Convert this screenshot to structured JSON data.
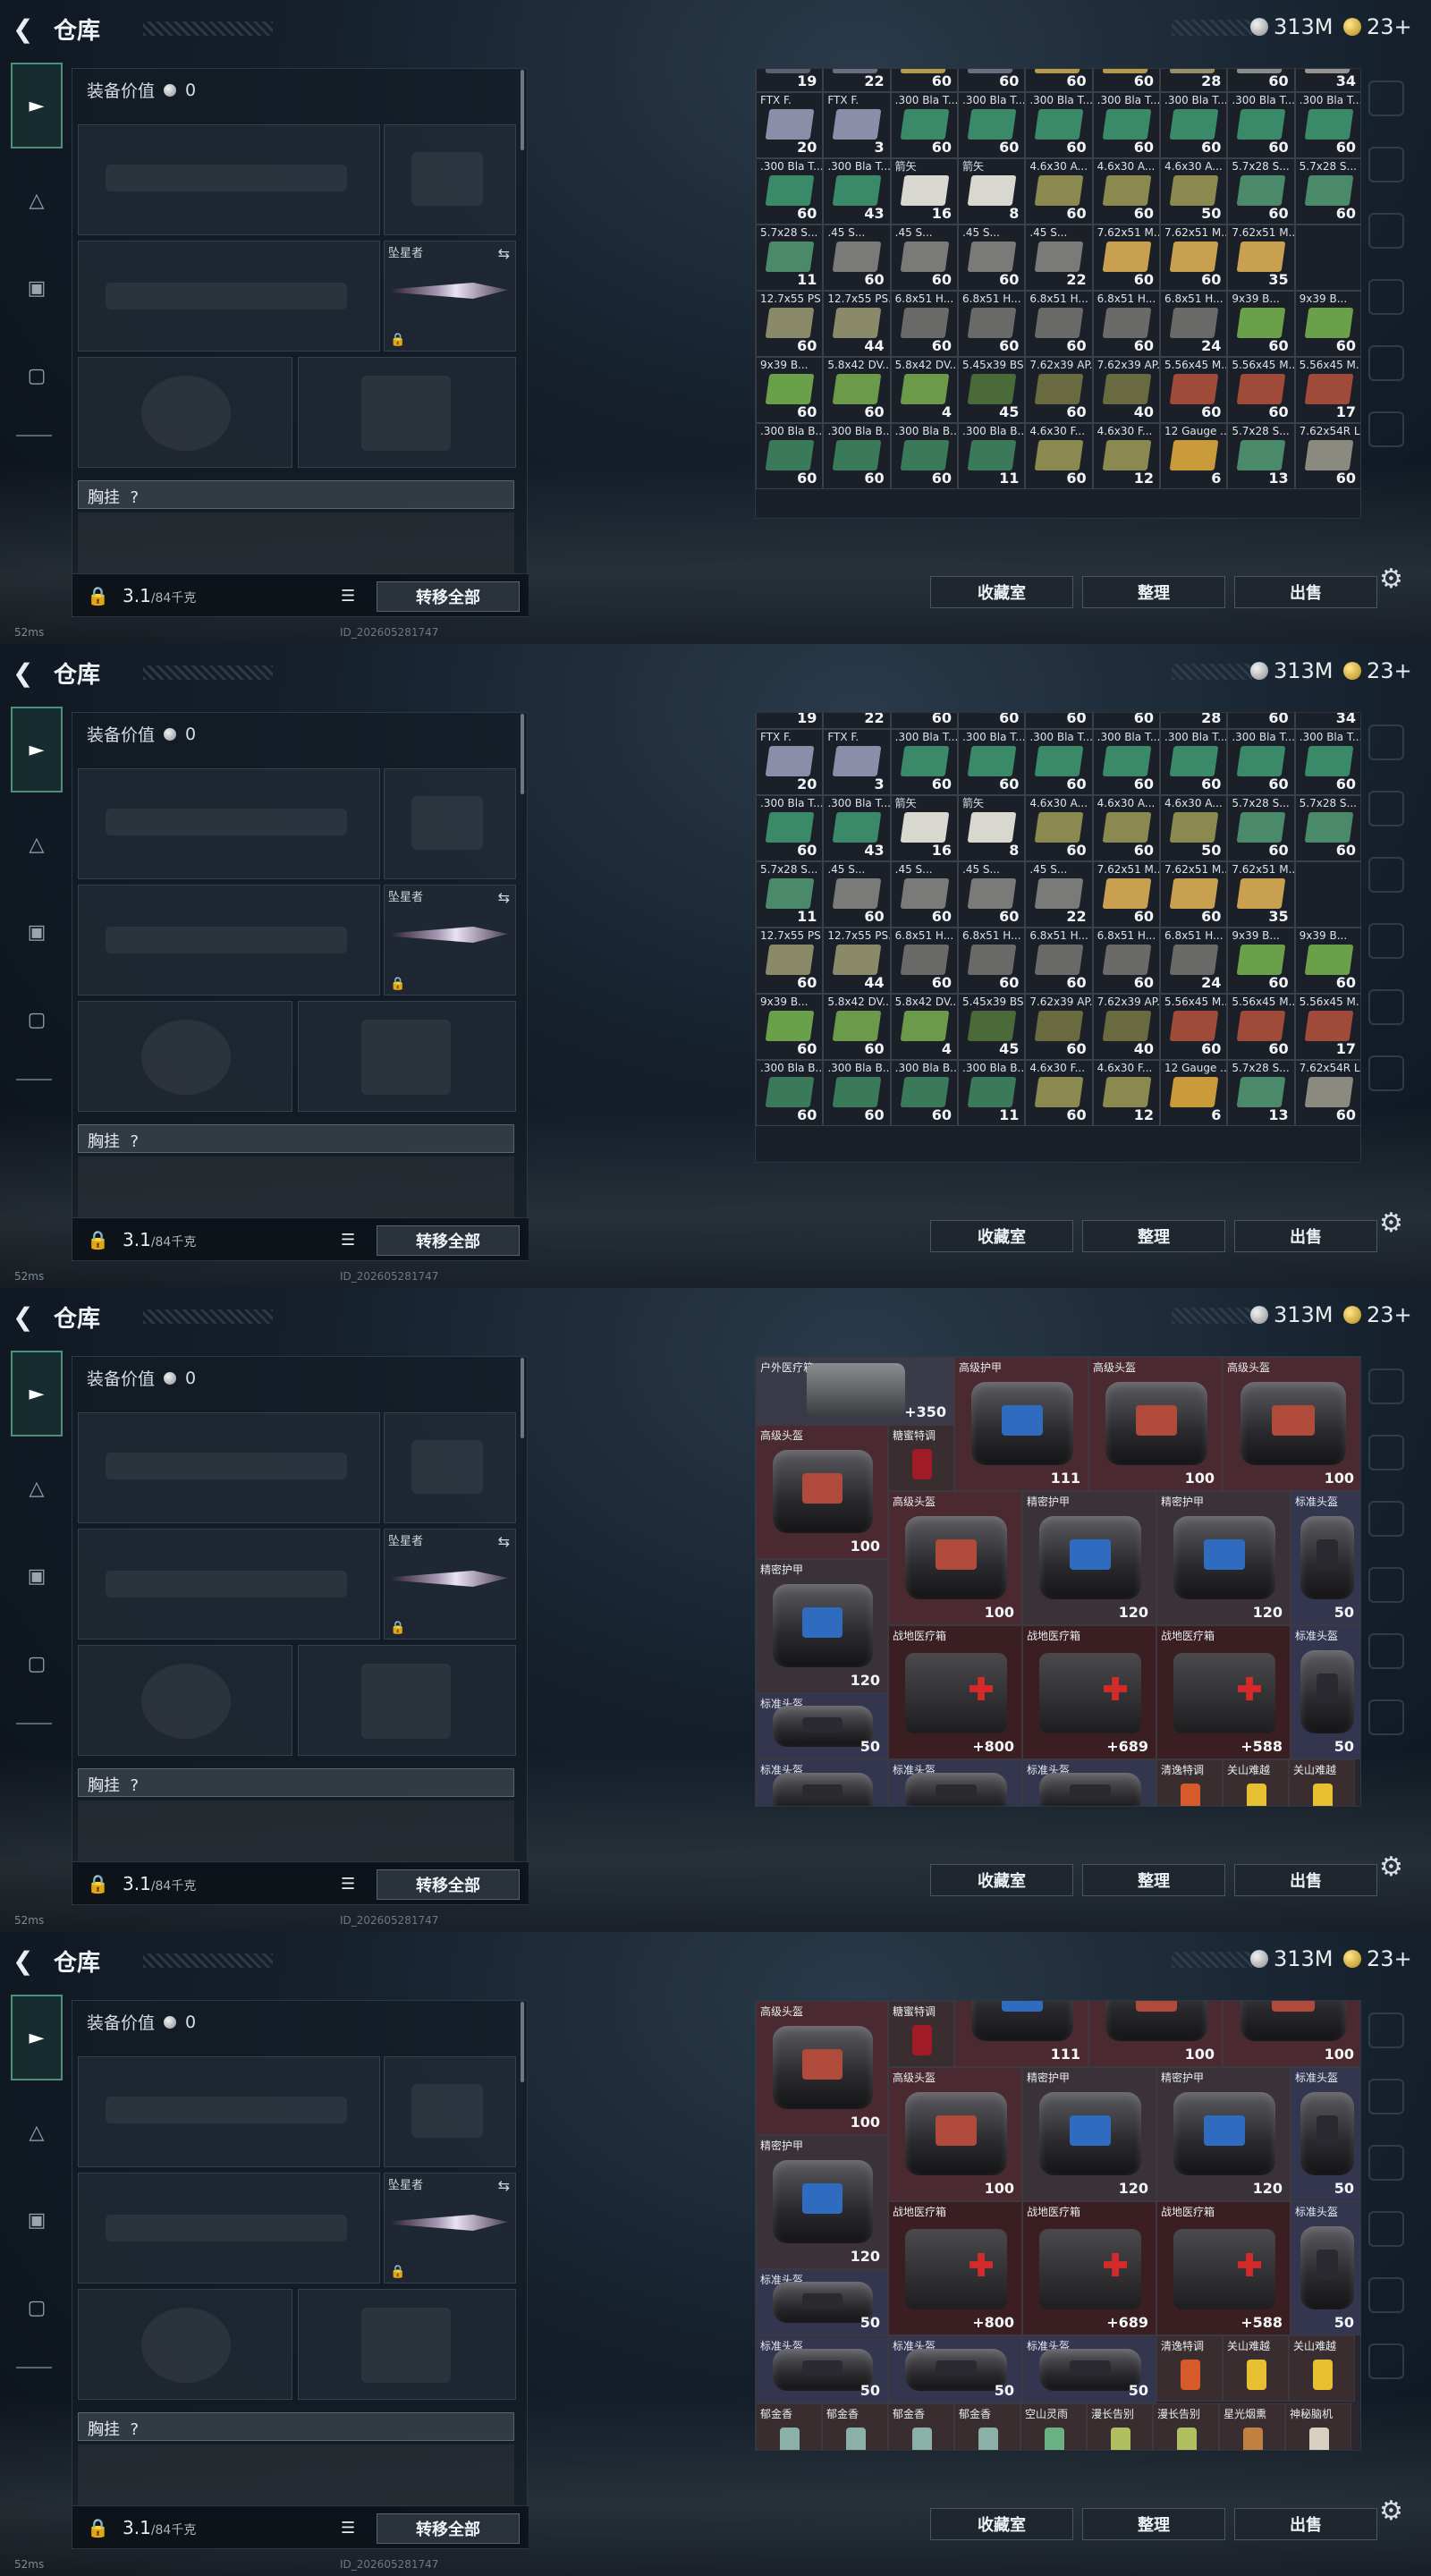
{
  "header": {
    "back_icon": "back-arrow-icon",
    "title": "仓库",
    "silver": "313M",
    "gold": "23+"
  },
  "loadout": {
    "value_label": "装备价值",
    "value": "0",
    "melee_name": "坠星者",
    "chest_label": "胸挂",
    "chest_help": "?",
    "weight": "3.1",
    "weight_max": "/84千克",
    "transfer_all": "转移全部"
  },
  "buttons": {
    "collection": "收藏室",
    "sort": "整理",
    "sell": "出售"
  },
  "status": {
    "ping": "52ms",
    "uid": "ID_202605281747"
  },
  "ammo_rows": [
    [
      {
        "n": "",
        "c": "19",
        "col": "#5a6070"
      },
      {
        "n": "",
        "c": "22",
        "col": "#6a6e80"
      },
      {
        "n": "",
        "c": "60",
        "col": "#b59a4a"
      },
      {
        "n": "",
        "c": "60",
        "col": "#6a6e80"
      },
      {
        "n": "",
        "c": "60",
        "col": "#b59a4a"
      },
      {
        "n": "",
        "c": "60",
        "col": "#b59a4a"
      },
      {
        "n": "",
        "c": "28",
        "col": "#9a8e6a"
      },
      {
        "n": "",
        "c": "60",
        "col": "#8a8e8a"
      },
      {
        "n": "",
        "c": "34",
        "col": "#9a9490"
      }
    ],
    [
      {
        "n": "FTX F.",
        "c": "20",
        "col": "#8a8ea8"
      },
      {
        "n": "FTX F.",
        "c": "3",
        "col": "#8a8ea8"
      },
      {
        "n": ".300 Bla T...X",
        "c": "60",
        "col": "#3a8a6a"
      },
      {
        "n": ".300 Bla T...X",
        "c": "60",
        "col": "#3a8a6a"
      },
      {
        "n": ".300 Bla T...X",
        "c": "60",
        "col": "#3a8a6a"
      },
      {
        "n": ".300 Bla T...X",
        "c": "60",
        "col": "#3a8a6a"
      },
      {
        "n": ".300 Bla T...X",
        "c": "60",
        "col": "#3a8a6a"
      },
      {
        "n": ".300 Bla T...X",
        "c": "60",
        "col": "#3a8a6a"
      },
      {
        "n": ".300 Bla T...X",
        "c": "60",
        "col": "#3a8a6a"
      }
    ],
    [
      {
        "n": ".300 Bla T...X",
        "c": "60",
        "col": "#3a8a6a"
      },
      {
        "n": ".300 Bla T...X",
        "c": "43",
        "col": "#3a8a6a"
      },
      {
        "n": "箭矢",
        "c": "16",
        "col": "#d8d8d0"
      },
      {
        "n": "箭矢",
        "c": "8",
        "col": "#d8d8d0"
      },
      {
        "n": "4.6x30 A...",
        "c": "60",
        "col": "#8a8a50"
      },
      {
        "n": "4.6x30 A...",
        "c": "60",
        "col": "#8a8a50"
      },
      {
        "n": "4.6x30 A...",
        "c": "50",
        "col": "#8a8a50"
      },
      {
        "n": "5.7x28 S...",
        "c": "60",
        "col": "#4a8a6a"
      },
      {
        "n": "5.7x28 S...",
        "c": "60",
        "col": "#4a8a6a"
      }
    ],
    [
      {
        "n": "5.7x28 S...",
        "c": "11",
        "col": "#4a8a6a"
      },
      {
        "n": ".45 S...",
        "c": "60",
        "col": "#7a7a78"
      },
      {
        "n": ".45 S...",
        "c": "60",
        "col": "#7a7a78"
      },
      {
        "n": ".45 S...",
        "c": "60",
        "col": "#7a7a78"
      },
      {
        "n": ".45 S...",
        "c": "22",
        "col": "#7a7a78"
      },
      {
        "n": "7.62x51 M...",
        "c": "60",
        "col": "#c8a050"
      },
      {
        "n": "7.62x51 M...",
        "c": "60",
        "col": "#c8a050"
      },
      {
        "n": "7.62x51 M...",
        "c": "35",
        "col": "#c8a050"
      }
    ],
    [
      {
        "n": "12.7x55 PS...",
        "c": "60",
        "col": "#8a8a6a"
      },
      {
        "n": "12.7x55 PS...",
        "c": "44",
        "col": "#8a8a6a"
      },
      {
        "n": "6.8x51 H...",
        "c": "60",
        "col": "#6a6a68"
      },
      {
        "n": "6.8x51 H...",
        "c": "60",
        "col": "#6a6a68"
      },
      {
        "n": "6.8x51 H...",
        "c": "60",
        "col": "#6a6a68"
      },
      {
        "n": "6.8x51 H...",
        "c": "60",
        "col": "#6a6a68"
      },
      {
        "n": "6.8x51 H...",
        "c": "24",
        "col": "#6a6a68"
      },
      {
        "n": "9x39 B...",
        "c": "60",
        "col": "#6aa04a"
      },
      {
        "n": "9x39 B...",
        "c": "60",
        "col": "#6aa04a"
      }
    ],
    [
      {
        "n": "9x39 B...",
        "c": "60",
        "col": "#6aa04a"
      },
      {
        "n": "5.8x42 DV...",
        "c": "60",
        "col": "#6a9a4a"
      },
      {
        "n": "5.8x42 DV...",
        "c": "4",
        "col": "#6a9a4a"
      },
      {
        "n": "5.45x39 BS...",
        "c": "45",
        "col": "#4a6a3a"
      },
      {
        "n": "7.62x39 AP...",
        "c": "60",
        "col": "#6a6a40"
      },
      {
        "n": "7.62x39 AP...",
        "c": "40",
        "col": "#6a6a40"
      },
      {
        "n": "5.56x45 M...",
        "c": "60",
        "col": "#a04a3a"
      },
      {
        "n": "5.56x45 M...",
        "c": "60",
        "col": "#a04a3a"
      },
      {
        "n": "5.56x45 M...",
        "c": "17",
        "col": "#a04a3a"
      }
    ],
    [
      {
        "n": ".300 Bla B...",
        "c": "60",
        "col": "#3a7a5a"
      },
      {
        "n": ".300 Bla B...",
        "c": "60",
        "col": "#3a7a5a"
      },
      {
        "n": ".300 Bla B...",
        "c": "60",
        "col": "#3a7a5a"
      },
      {
        "n": ".300 Bla B...",
        "c": "11",
        "col": "#3a7a5a"
      },
      {
        "n": "4.6x30 F...",
        "c": "60",
        "col": "#8a8a50"
      },
      {
        "n": "4.6x30 F...",
        "c": "12",
        "col": "#8a8a50"
      },
      {
        "n": "12 Gauge ...",
        "c": "6",
        "col": "#c89a3a"
      },
      {
        "n": "5.7x28 S...",
        "c": "13",
        "col": "#4a8a6a"
      },
      {
        "n": "7.62x54R L...",
        "c": "60",
        "col": "#8a8a80"
      }
    ]
  ],
  "gear_items": {
    "outdoor_med": {
      "n": "户外医疗箱",
      "v": "+350"
    },
    "adv_armor": {
      "n": "高级护甲",
      "v": "111"
    },
    "adv_helmet": {
      "n": "高级头盔",
      "v": "100"
    },
    "honey": {
      "n": "糖蜜特调"
    },
    "precision_armor": {
      "n": "精密护甲",
      "v": "120"
    },
    "std_helmet": {
      "n": "标准头盔",
      "v": "50"
    },
    "field_med": {
      "n": "战地医疗箱",
      "v1": "+800",
      "v2": "+689",
      "v3": "+588"
    },
    "clear_drink": {
      "n": "清逸特调"
    },
    "guanshan": {
      "n": "关山难越"
    },
    "yujinxiang": {
      "n": "郁金香"
    },
    "kongshan": {
      "n": "空山灵雨"
    },
    "manchang": {
      "n": "漫长告别"
    },
    "xingguang": {
      "n": "星光烟熏"
    },
    "shenmi": {
      "n": "神秘脑机"
    }
  }
}
